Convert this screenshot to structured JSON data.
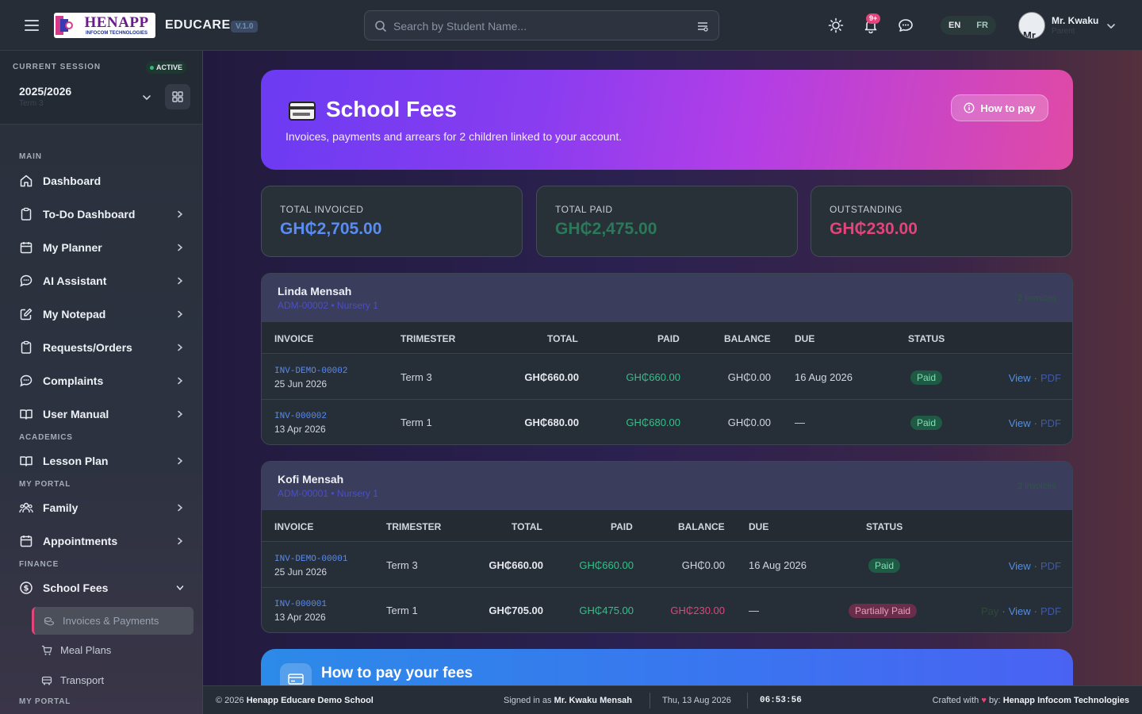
{
  "header": {
    "logo_main": "HENAPP",
    "logo_sub": "INFOCOM TECHNOLOGIES",
    "brand": "EDUCARE",
    "version": "V.1.0",
    "search_placeholder": "Search by Student Name...",
    "notif_badge": "9+",
    "lang_en": "EN",
    "lang_fr": "FR",
    "user_name": "Mr. Kwaku",
    "user_role": "Parent",
    "avatar_text": "Mr"
  },
  "session": {
    "label": "CURRENT SESSION",
    "status": "ACTIVE",
    "year": "2025/2026",
    "term": "Term 3"
  },
  "nav": {
    "main_heading": "MAIN",
    "dashboard": "Dashboard",
    "todo": "To-Do Dashboard",
    "planner": "My Planner",
    "ai": "AI Assistant",
    "notepad": "My Notepad",
    "requests": "Requests/Orders",
    "complaints": "Complaints",
    "manual": "User Manual",
    "academics_heading": "ACADEMICS",
    "lesson": "Lesson Plan",
    "portal_heading": "MY PORTAL",
    "family": "Family",
    "appointments": "Appointments",
    "finance_heading": "FINANCE",
    "fees": "School Fees",
    "sub_invoices": "Invoices & Payments",
    "sub_meal": "Meal Plans",
    "sub_transport": "Transport",
    "portal_heading2": "MY PORTAL"
  },
  "hero": {
    "title": "School Fees",
    "subtitle": "Invoices, payments and arrears for 2 children linked to your account.",
    "how_btn": "How to pay"
  },
  "stats": {
    "invoiced_label": "TOTAL INVOICED",
    "invoiced_value": "GH₵2,705.00",
    "paid_label": "TOTAL PAID",
    "paid_value": "GH₵2,475.00",
    "outstanding_label": "OUTSTANDING",
    "outstanding_value": "GH₵230.00"
  },
  "columns": {
    "invoice": "INVOICE",
    "trimester": "TRIMESTER",
    "total": "TOTAL",
    "paid": "PAID",
    "balance": "BALANCE",
    "due": "DUE",
    "status": "STATUS"
  },
  "actions": {
    "view": "View",
    "pdf": "PDF",
    "pay": "Pay",
    "dot": "·"
  },
  "children": [
    {
      "name": "Linda Mensah",
      "adm": "ADM-00002 • Nursery 1",
      "count": "2 invoices",
      "rows": [
        {
          "invoice": "INV-DEMO-00002",
          "date": "25 Jun 2026",
          "trimester": "Term 3",
          "total": "GH₵660.00",
          "paid": "GH₵660.00",
          "balance": "GH₵0.00",
          "due": "16 Aug 2026",
          "status": "Paid"
        },
        {
          "invoice": "INV-000002",
          "date": "13 Apr 2026",
          "trimester": "Term 1",
          "total": "GH₵680.00",
          "paid": "GH₵680.00",
          "balance": "GH₵0.00",
          "due": "—",
          "status": "Paid"
        }
      ]
    },
    {
      "name": "Kofi Mensah",
      "adm": "ADM-00001 • Nursery 1",
      "count": "2 invoices",
      "rows": [
        {
          "invoice": "INV-DEMO-00001",
          "date": "25 Jun 2026",
          "trimester": "Term 3",
          "total": "GH₵660.00",
          "paid": "GH₵660.00",
          "balance": "GH₵0.00",
          "due": "16 Aug 2026",
          "status": "Paid"
        },
        {
          "invoice": "INV-000001",
          "date": "13 Apr 2026",
          "trimester": "Term 1",
          "total": "GH₵705.00",
          "paid": "GH₵475.00",
          "balance": "GH₵230.00",
          "due": "—",
          "status": "Partially Paid"
        }
      ]
    }
  ],
  "how_card": {
    "title": "How to pay your fees"
  },
  "footer": {
    "copy_prefix": "© 2026",
    "school": "Henapp Educare Demo School",
    "signed_prefix": "Signed in as",
    "signed_user": "Mr. Kwaku Mensah",
    "date": "Thu, 13 Aug 2026",
    "time": "06:53:56",
    "crafted_prefix": "Crafted with",
    "crafted_by": "by:",
    "company": "Henapp Infocom Technologies"
  },
  "colors": {
    "accent_blue": "#5b8cf0",
    "paid_green": "#34c08a",
    "outstanding_pink": "#e3447a",
    "hero_start": "#6b3bf2",
    "hero_end": "#e04aa5"
  }
}
